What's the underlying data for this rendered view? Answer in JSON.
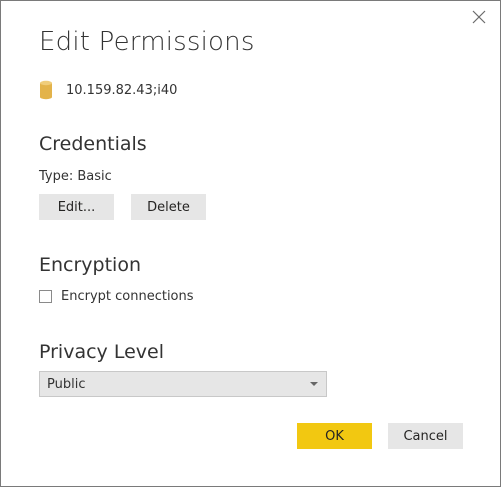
{
  "dialog": {
    "title": "Edit Permissions",
    "close_icon": "close-icon"
  },
  "source": {
    "icon": "database-icon",
    "text": "10.159.82.43;i40"
  },
  "credentials": {
    "heading": "Credentials",
    "type_label": "Type: Basic",
    "edit_label": "Edit...",
    "delete_label": "Delete"
  },
  "encryption": {
    "heading": "Encryption",
    "checkbox_label": "Encrypt connections",
    "checked": false
  },
  "privacy": {
    "heading": "Privacy Level",
    "selected": "Public"
  },
  "footer": {
    "ok_label": "OK",
    "cancel_label": "Cancel"
  },
  "colors": {
    "accent": "#f2c811",
    "button_bg": "#e6e6e6",
    "db_icon": "#e3b34a"
  }
}
